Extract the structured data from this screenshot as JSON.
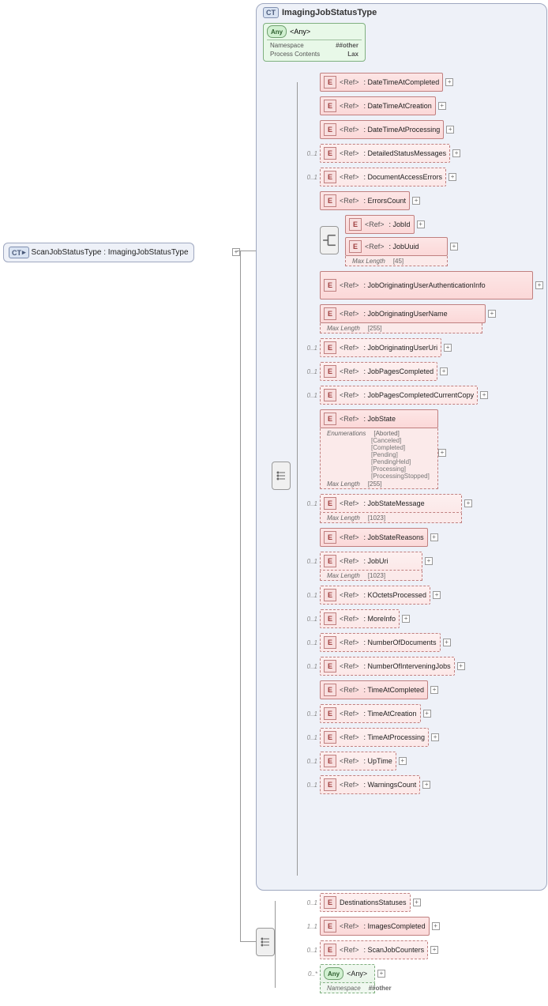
{
  "root": {
    "name": "ScanJobStatusType : ImagingJobStatusType",
    "badge": "CT"
  },
  "complexType": {
    "badge": "CT",
    "name": "ImagingJobStatusType"
  },
  "any": {
    "badge": "Any",
    "label": "<Any>",
    "rows": [
      {
        "label": "Namespace",
        "value": "##other"
      },
      {
        "label": "Process Contents",
        "value": "Lax"
      }
    ]
  },
  "refLabel": "<Ref>",
  "eBadge": "E",
  "anyBadge": "Any",
  "elements": [
    {
      "name": ": DateTimeAtCompleted",
      "occ": "",
      "dashed": false,
      "plus": true
    },
    {
      "name": ": DateTimeAtCreation",
      "occ": "",
      "dashed": false,
      "plus": true
    },
    {
      "name": ": DateTimeAtProcessing",
      "occ": "",
      "dashed": false,
      "plus": true
    },
    {
      "name": ": DetailedStatusMessages",
      "occ": "0..1",
      "dashed": true,
      "plus": true
    },
    {
      "name": ": DocumentAccessErrors",
      "occ": "0..1",
      "dashed": true,
      "plus": true
    },
    {
      "name": ": ErrorsCount",
      "occ": "",
      "dashed": false,
      "plus": true
    }
  ],
  "choice": {
    "jobId": {
      "name": ": JobId",
      "plus": true
    },
    "jobUuid": {
      "name": ": JobUuid",
      "constraint": {
        "label": "Max Length",
        "value": "[45]"
      },
      "plus": true
    }
  },
  "elements2": [
    {
      "name": ": JobOriginatingUserAuthenticationInfo",
      "occ": "",
      "dashed": false,
      "wide": true,
      "plus": true
    },
    {
      "name": ": JobOriginatingUserName",
      "occ": "",
      "dashed": false,
      "constraint": {
        "label": "Max Length",
        "value": "[255]"
      },
      "plus": true
    },
    {
      "name": ": JobOriginatingUserUri",
      "occ": "0..1",
      "dashed": true,
      "plus": true
    },
    {
      "name": ": JobPagesCompleted",
      "occ": "0..1",
      "dashed": true,
      "plus": true
    },
    {
      "name": ": JobPagesCompletedCurrentCopy",
      "occ": "0..1",
      "dashed": true,
      "plus": true
    }
  ],
  "jobState": {
    "name": ": JobState",
    "enumLabel": "Enumerations",
    "enums": [
      "[Aborted]",
      "[Canceled]",
      "[Completed]",
      "[Pending]",
      "[PendingHeld]",
      "[Processing]",
      "[ProcessingStopped]"
    ],
    "maxLengthLabel": "Max Length",
    "maxLength": "[255]"
  },
  "elements3": [
    {
      "name": ": JobStateMessage",
      "occ": "0..1",
      "dashed": true,
      "constraint": {
        "label": "Max Length",
        "value": "[1023]"
      },
      "plus": true
    },
    {
      "name": ": JobStateReasons",
      "occ": "",
      "dashed": false,
      "plus": true
    },
    {
      "name": ": JobUri",
      "occ": "0..1",
      "dashed": true,
      "constraint": {
        "label": "Max Length",
        "value": "[1023]"
      },
      "plus": true
    },
    {
      "name": ": KOctetsProcessed",
      "occ": "0..1",
      "dashed": true,
      "plus": true
    },
    {
      "name": ": MoreInfo",
      "occ": "0..1",
      "dashed": true,
      "plus": true
    },
    {
      "name": ": NumberOfDocuments",
      "occ": "0..1",
      "dashed": true,
      "plus": true
    },
    {
      "name": ": NumberOfInterveningJobs",
      "occ": "0..1",
      "dashed": true,
      "plus": true
    },
    {
      "name": ": TimeAtCompleted",
      "occ": "",
      "dashed": false,
      "plus": true
    },
    {
      "name": ": TimeAtCreation",
      "occ": "0..1",
      "dashed": true,
      "plus": true
    },
    {
      "name": ": TimeAtProcessing",
      "occ": "0..1",
      "dashed": true,
      "plus": true
    },
    {
      "name": ": UpTime",
      "occ": "0..1",
      "dashed": true,
      "plus": true
    },
    {
      "name": ": WarningsCount",
      "occ": "0..1",
      "dashed": true,
      "plus": true
    }
  ],
  "outerElements": [
    {
      "name": "DestinationsStatuses",
      "occ": "0..1",
      "dashed": true,
      "plus": true,
      "noRef": true
    },
    {
      "name": ": ImagesCompleted",
      "occ": "1..1",
      "dashed": false,
      "plus": true
    },
    {
      "name": ": ScanJobCounters",
      "occ": "0..1",
      "dashed": true,
      "plus": true
    }
  ],
  "outerAny": {
    "badge": "Any",
    "label": "<Any>",
    "occ": "0..*",
    "constraint": {
      "label": "Namespace",
      "value": "##other"
    }
  },
  "chart_data": {
    "type": "diagram",
    "description": "XSD schema tree diagram",
    "rootType": "ScanJobStatusType",
    "baseType": "ImagingJobStatusType",
    "structure": {
      "ImagingJobStatusType": {
        "any": {
          "namespace": "##other",
          "processContents": "Lax"
        },
        "sequence": [
          {
            "ref": "DateTimeAtCompleted"
          },
          {
            "ref": "DateTimeAtCreation"
          },
          {
            "ref": "DateTimeAtProcessing"
          },
          {
            "ref": "DetailedStatusMessages",
            "minOccurs": 0,
            "maxOccurs": 1
          },
          {
            "ref": "DocumentAccessErrors",
            "minOccurs": 0,
            "maxOccurs": 1
          },
          {
            "ref": "ErrorsCount"
          },
          {
            "choice": [
              {
                "ref": "JobId"
              },
              {
                "ref": "JobUuid",
                "maxLength": 45
              }
            ]
          },
          {
            "ref": "JobOriginatingUserAuthenticationInfo"
          },
          {
            "ref": "JobOriginatingUserName",
            "maxLength": 255
          },
          {
            "ref": "JobOriginatingUserUri",
            "minOccurs": 0,
            "maxOccurs": 1
          },
          {
            "ref": "JobPagesCompleted",
            "minOccurs": 0,
            "maxOccurs": 1
          },
          {
            "ref": "JobPagesCompletedCurrentCopy",
            "minOccurs": 0,
            "maxOccurs": 1
          },
          {
            "ref": "JobState",
            "enumerations": [
              "Aborted",
              "Canceled",
              "Completed",
              "Pending",
              "PendingHeld",
              "Processing",
              "ProcessingStopped"
            ],
            "maxLength": 255
          },
          {
            "ref": "JobStateMessage",
            "minOccurs": 0,
            "maxOccurs": 1,
            "maxLength": 1023
          },
          {
            "ref": "JobStateReasons"
          },
          {
            "ref": "JobUri",
            "minOccurs": 0,
            "maxOccurs": 1,
            "maxLength": 1023
          },
          {
            "ref": "KOctetsProcessed",
            "minOccurs": 0,
            "maxOccurs": 1
          },
          {
            "ref": "MoreInfo",
            "minOccurs": 0,
            "maxOccurs": 1
          },
          {
            "ref": "NumberOfDocuments",
            "minOccurs": 0,
            "maxOccurs": 1
          },
          {
            "ref": "NumberOfInterveningJobs",
            "minOccurs": 0,
            "maxOccurs": 1
          },
          {
            "ref": "TimeAtCompleted"
          },
          {
            "ref": "TimeAtCreation",
            "minOccurs": 0,
            "maxOccurs": 1
          },
          {
            "ref": "TimeAtProcessing",
            "minOccurs": 0,
            "maxOccurs": 1
          },
          {
            "ref": "UpTime",
            "minOccurs": 0,
            "maxOccurs": 1
          },
          {
            "ref": "WarningsCount",
            "minOccurs": 0,
            "maxOccurs": 1
          }
        ]
      },
      "extensionSequence": [
        {
          "element": "DestinationsStatuses",
          "minOccurs": 0,
          "maxOccurs": 1
        },
        {
          "ref": "ImagesCompleted",
          "minOccurs": 1,
          "maxOccurs": 1
        },
        {
          "ref": "ScanJobCounters",
          "minOccurs": 0,
          "maxOccurs": 1
        },
        {
          "any": {
            "namespace": "##other"
          },
          "minOccurs": 0,
          "maxOccurs": "unbounded"
        }
      ]
    }
  }
}
